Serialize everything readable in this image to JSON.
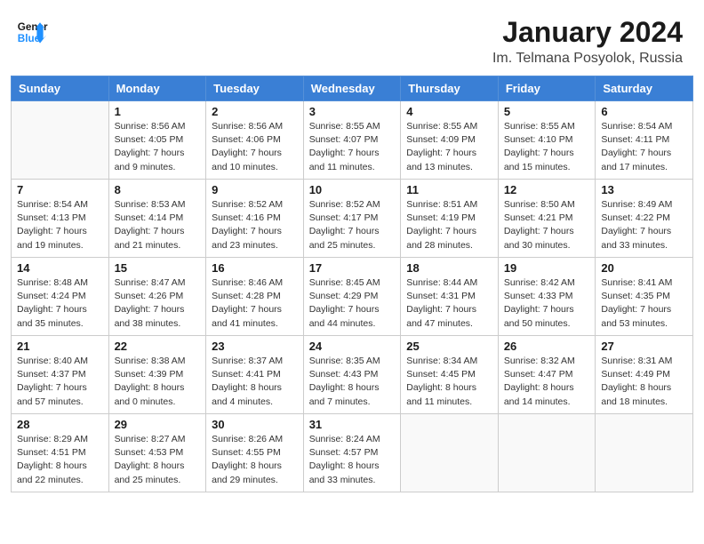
{
  "header": {
    "logo_general": "General",
    "logo_blue": "Blue",
    "month": "January 2024",
    "location": "Im. Telmana Posyolok, Russia"
  },
  "days_of_week": [
    "Sunday",
    "Monday",
    "Tuesday",
    "Wednesday",
    "Thursday",
    "Friday",
    "Saturday"
  ],
  "weeks": [
    [
      {
        "day": "",
        "info": ""
      },
      {
        "day": "1",
        "info": "Sunrise: 8:56 AM\nSunset: 4:05 PM\nDaylight: 7 hours\nand 9 minutes."
      },
      {
        "day": "2",
        "info": "Sunrise: 8:56 AM\nSunset: 4:06 PM\nDaylight: 7 hours\nand 10 minutes."
      },
      {
        "day": "3",
        "info": "Sunrise: 8:55 AM\nSunset: 4:07 PM\nDaylight: 7 hours\nand 11 minutes."
      },
      {
        "day": "4",
        "info": "Sunrise: 8:55 AM\nSunset: 4:09 PM\nDaylight: 7 hours\nand 13 minutes."
      },
      {
        "day": "5",
        "info": "Sunrise: 8:55 AM\nSunset: 4:10 PM\nDaylight: 7 hours\nand 15 minutes."
      },
      {
        "day": "6",
        "info": "Sunrise: 8:54 AM\nSunset: 4:11 PM\nDaylight: 7 hours\nand 17 minutes."
      }
    ],
    [
      {
        "day": "7",
        "info": "Sunrise: 8:54 AM\nSunset: 4:13 PM\nDaylight: 7 hours\nand 19 minutes."
      },
      {
        "day": "8",
        "info": "Sunrise: 8:53 AM\nSunset: 4:14 PM\nDaylight: 7 hours\nand 21 minutes."
      },
      {
        "day": "9",
        "info": "Sunrise: 8:52 AM\nSunset: 4:16 PM\nDaylight: 7 hours\nand 23 minutes."
      },
      {
        "day": "10",
        "info": "Sunrise: 8:52 AM\nSunset: 4:17 PM\nDaylight: 7 hours\nand 25 minutes."
      },
      {
        "day": "11",
        "info": "Sunrise: 8:51 AM\nSunset: 4:19 PM\nDaylight: 7 hours\nand 28 minutes."
      },
      {
        "day": "12",
        "info": "Sunrise: 8:50 AM\nSunset: 4:21 PM\nDaylight: 7 hours\nand 30 minutes."
      },
      {
        "day": "13",
        "info": "Sunrise: 8:49 AM\nSunset: 4:22 PM\nDaylight: 7 hours\nand 33 minutes."
      }
    ],
    [
      {
        "day": "14",
        "info": "Sunrise: 8:48 AM\nSunset: 4:24 PM\nDaylight: 7 hours\nand 35 minutes."
      },
      {
        "day": "15",
        "info": "Sunrise: 8:47 AM\nSunset: 4:26 PM\nDaylight: 7 hours\nand 38 minutes."
      },
      {
        "day": "16",
        "info": "Sunrise: 8:46 AM\nSunset: 4:28 PM\nDaylight: 7 hours\nand 41 minutes."
      },
      {
        "day": "17",
        "info": "Sunrise: 8:45 AM\nSunset: 4:29 PM\nDaylight: 7 hours\nand 44 minutes."
      },
      {
        "day": "18",
        "info": "Sunrise: 8:44 AM\nSunset: 4:31 PM\nDaylight: 7 hours\nand 47 minutes."
      },
      {
        "day": "19",
        "info": "Sunrise: 8:42 AM\nSunset: 4:33 PM\nDaylight: 7 hours\nand 50 minutes."
      },
      {
        "day": "20",
        "info": "Sunrise: 8:41 AM\nSunset: 4:35 PM\nDaylight: 7 hours\nand 53 minutes."
      }
    ],
    [
      {
        "day": "21",
        "info": "Sunrise: 8:40 AM\nSunset: 4:37 PM\nDaylight: 7 hours\nand 57 minutes."
      },
      {
        "day": "22",
        "info": "Sunrise: 8:38 AM\nSunset: 4:39 PM\nDaylight: 8 hours\nand 0 minutes."
      },
      {
        "day": "23",
        "info": "Sunrise: 8:37 AM\nSunset: 4:41 PM\nDaylight: 8 hours\nand 4 minutes."
      },
      {
        "day": "24",
        "info": "Sunrise: 8:35 AM\nSunset: 4:43 PM\nDaylight: 8 hours\nand 7 minutes."
      },
      {
        "day": "25",
        "info": "Sunrise: 8:34 AM\nSunset: 4:45 PM\nDaylight: 8 hours\nand 11 minutes."
      },
      {
        "day": "26",
        "info": "Sunrise: 8:32 AM\nSunset: 4:47 PM\nDaylight: 8 hours\nand 14 minutes."
      },
      {
        "day": "27",
        "info": "Sunrise: 8:31 AM\nSunset: 4:49 PM\nDaylight: 8 hours\nand 18 minutes."
      }
    ],
    [
      {
        "day": "28",
        "info": "Sunrise: 8:29 AM\nSunset: 4:51 PM\nDaylight: 8 hours\nand 22 minutes."
      },
      {
        "day": "29",
        "info": "Sunrise: 8:27 AM\nSunset: 4:53 PM\nDaylight: 8 hours\nand 25 minutes."
      },
      {
        "day": "30",
        "info": "Sunrise: 8:26 AM\nSunset: 4:55 PM\nDaylight: 8 hours\nand 29 minutes."
      },
      {
        "day": "31",
        "info": "Sunrise: 8:24 AM\nSunset: 4:57 PM\nDaylight: 8 hours\nand 33 minutes."
      },
      {
        "day": "",
        "info": ""
      },
      {
        "day": "",
        "info": ""
      },
      {
        "day": "",
        "info": ""
      }
    ]
  ]
}
